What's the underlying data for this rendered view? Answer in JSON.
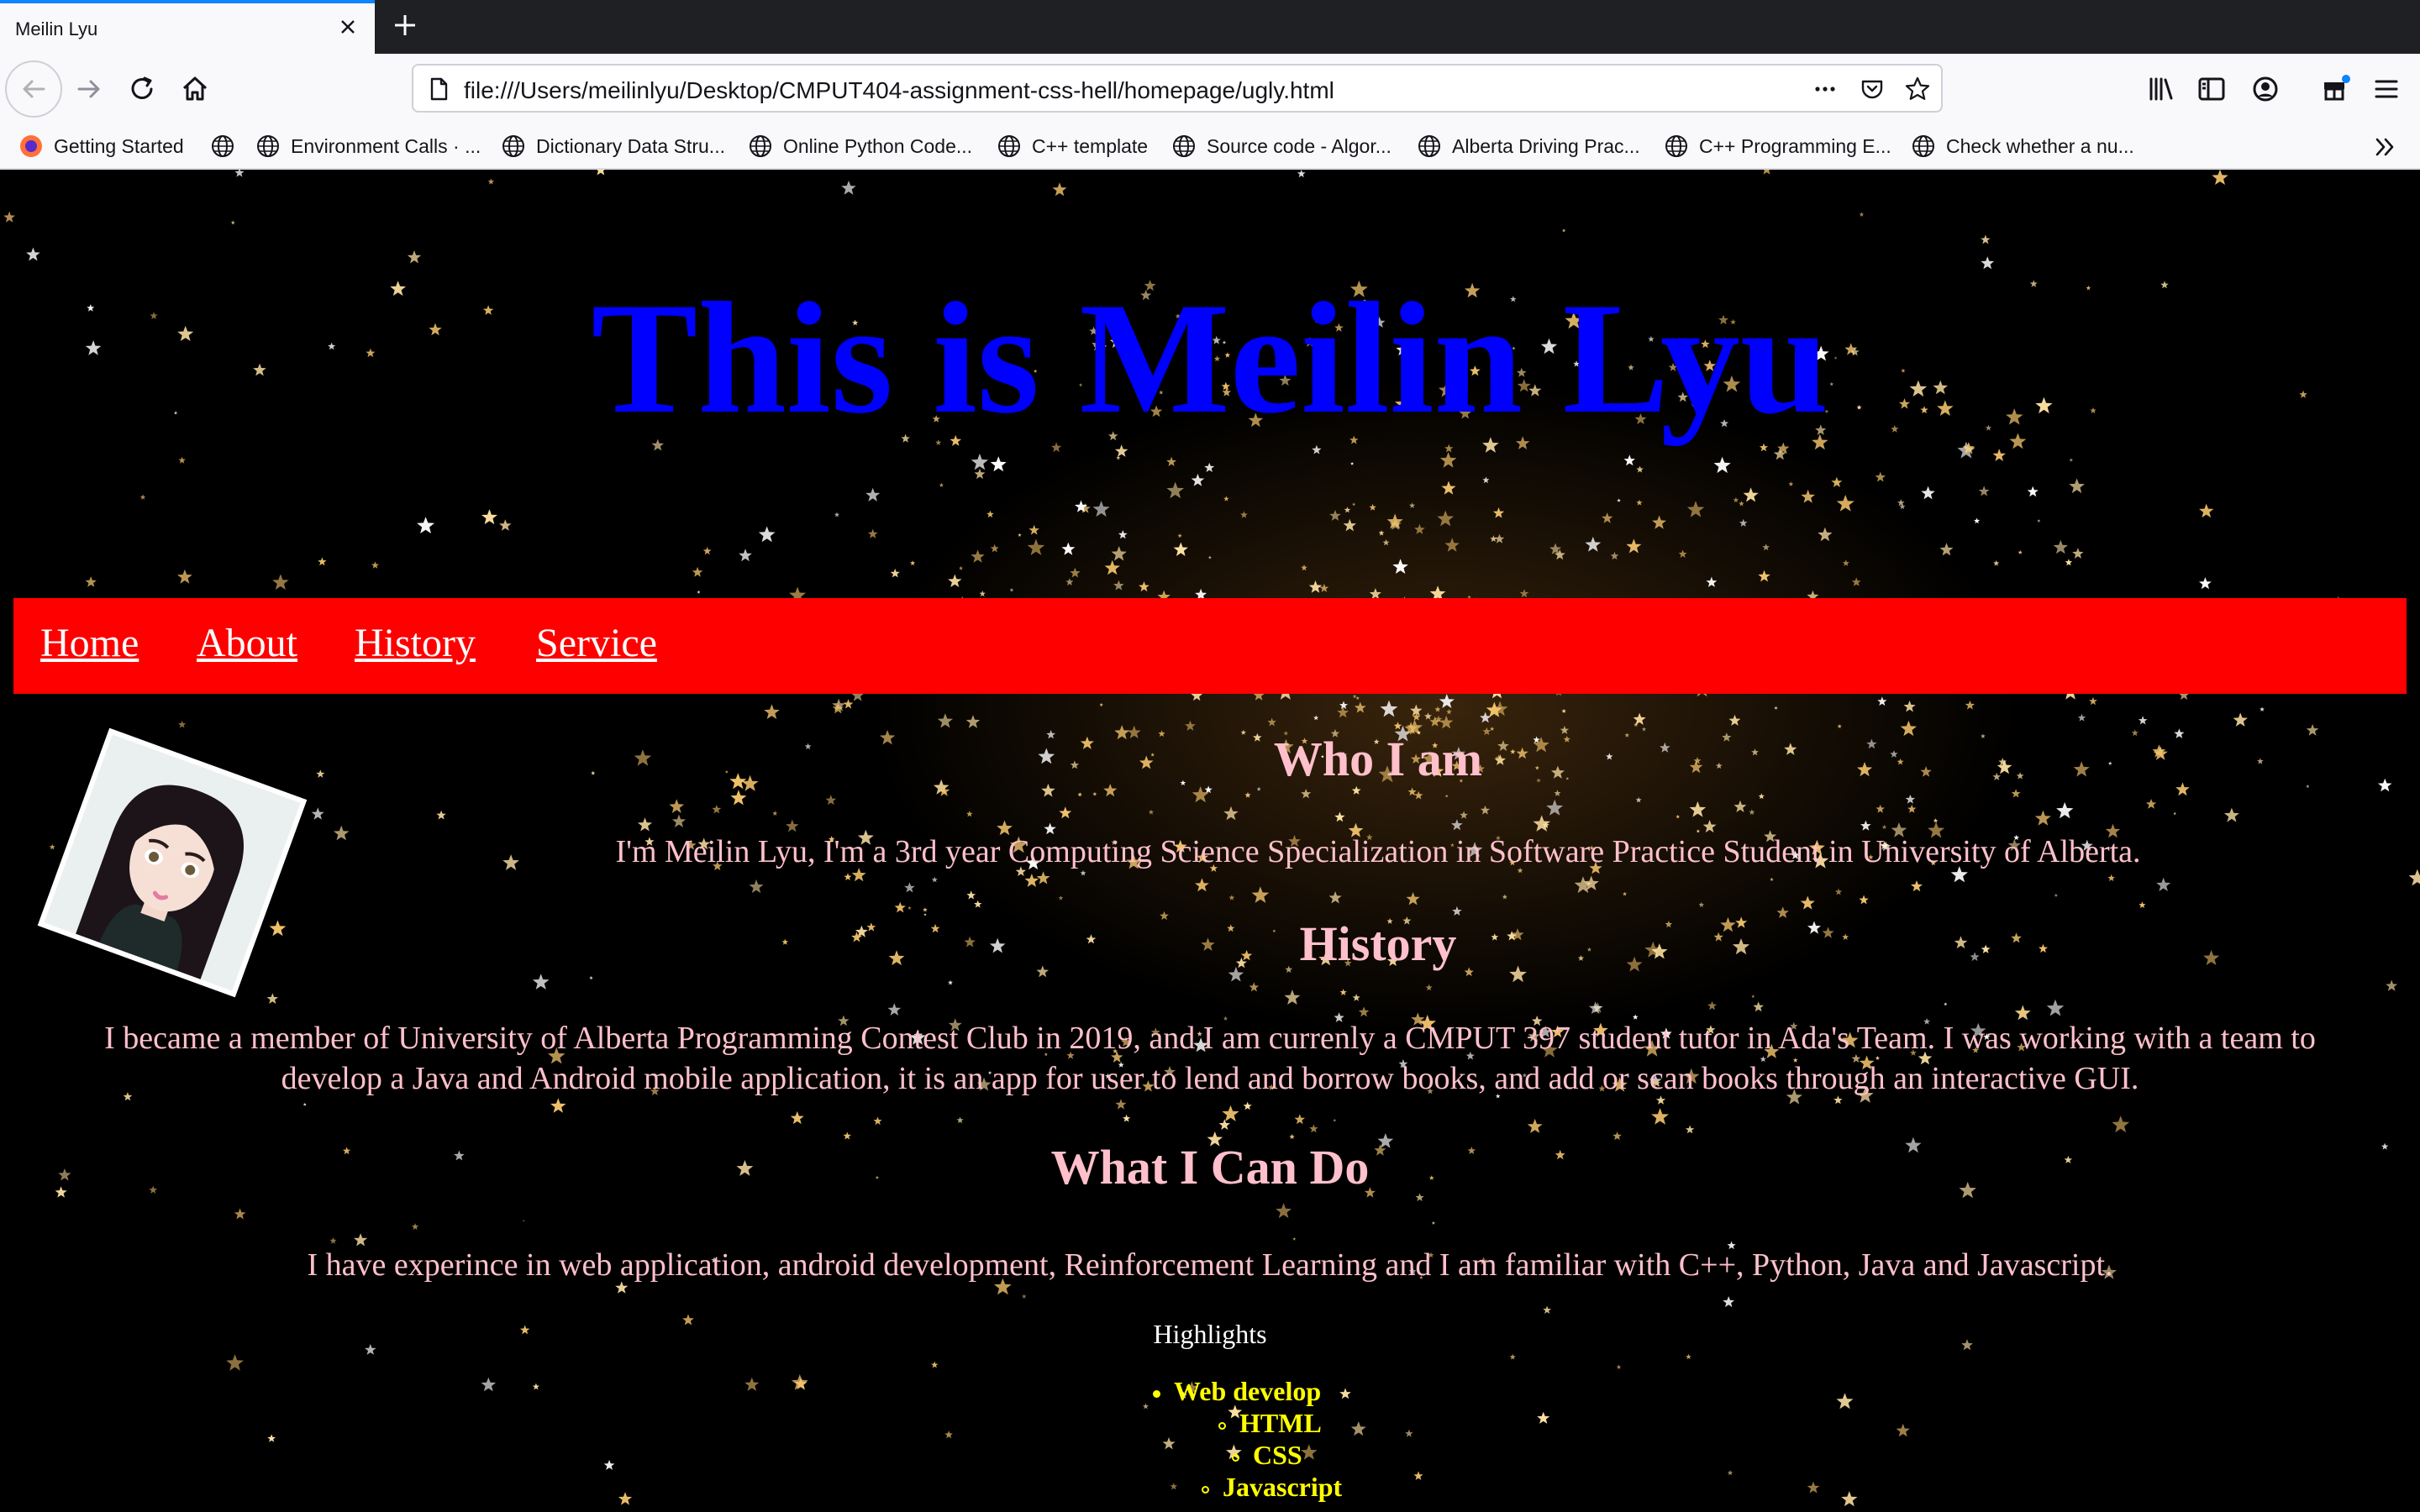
{
  "browser": {
    "tab_title": "Meilin Lyu",
    "url": "file:///Users/meilinlyu/Desktop/CMPUT404-assignment-css-hell/homepage/ugly.html",
    "bookmarks": [
      {
        "label": "Getting Started",
        "icon": "firefox-icon"
      },
      {
        "label": "",
        "icon": "globe-icon"
      },
      {
        "label": "Environment Calls · ...",
        "icon": "globe-icon"
      },
      {
        "label": "Dictionary Data Stru...",
        "icon": "globe-icon"
      },
      {
        "label": "Online Python Code...",
        "icon": "globe-icon"
      },
      {
        "label": "C++ template",
        "icon": "globe-icon"
      },
      {
        "label": "Source code - Algor...",
        "icon": "globe-icon"
      },
      {
        "label": "Alberta Driving Prac...",
        "icon": "globe-icon"
      },
      {
        "label": "C++ Programming E...",
        "icon": "globe-icon"
      },
      {
        "label": "Check whether a nu...",
        "icon": "globe-icon"
      }
    ]
  },
  "page": {
    "title": "This is Meilin Lyu",
    "menu": [
      "Home",
      "About",
      "History",
      "Service"
    ],
    "who_heading": "Who I am",
    "who_text": "I'm Meilin Lyu, I'm a 3rd year Computing Science Specialization in Software Practice Student in University of Alberta.",
    "history_heading": "History",
    "history_line1": "I became a member of University of Alberta Programming Contest Club in 2019, and I am currenly a CMPUT 397 student tutor in Ada's Team. I was working with a team to",
    "history_line2": "develop a Java and Android mobile application, it is an app for user to lend and borrow books, and add or scan books through an interactive GUI.",
    "can_heading": "What I Can Do",
    "can_text": "I have experince in web application, android development, Reinforcement Learning and I am familiar with C++, Python, Java and Javascript.",
    "highlights_label": "Highlights",
    "highlights": {
      "item": "Web develop",
      "subitems": [
        "HTML",
        "CSS",
        "Javascript"
      ]
    }
  },
  "colors": {
    "title": "#0000ff",
    "menu_bar": "#ff0000",
    "body_text": "#ffc0cb",
    "list_text": "#ffff00"
  }
}
